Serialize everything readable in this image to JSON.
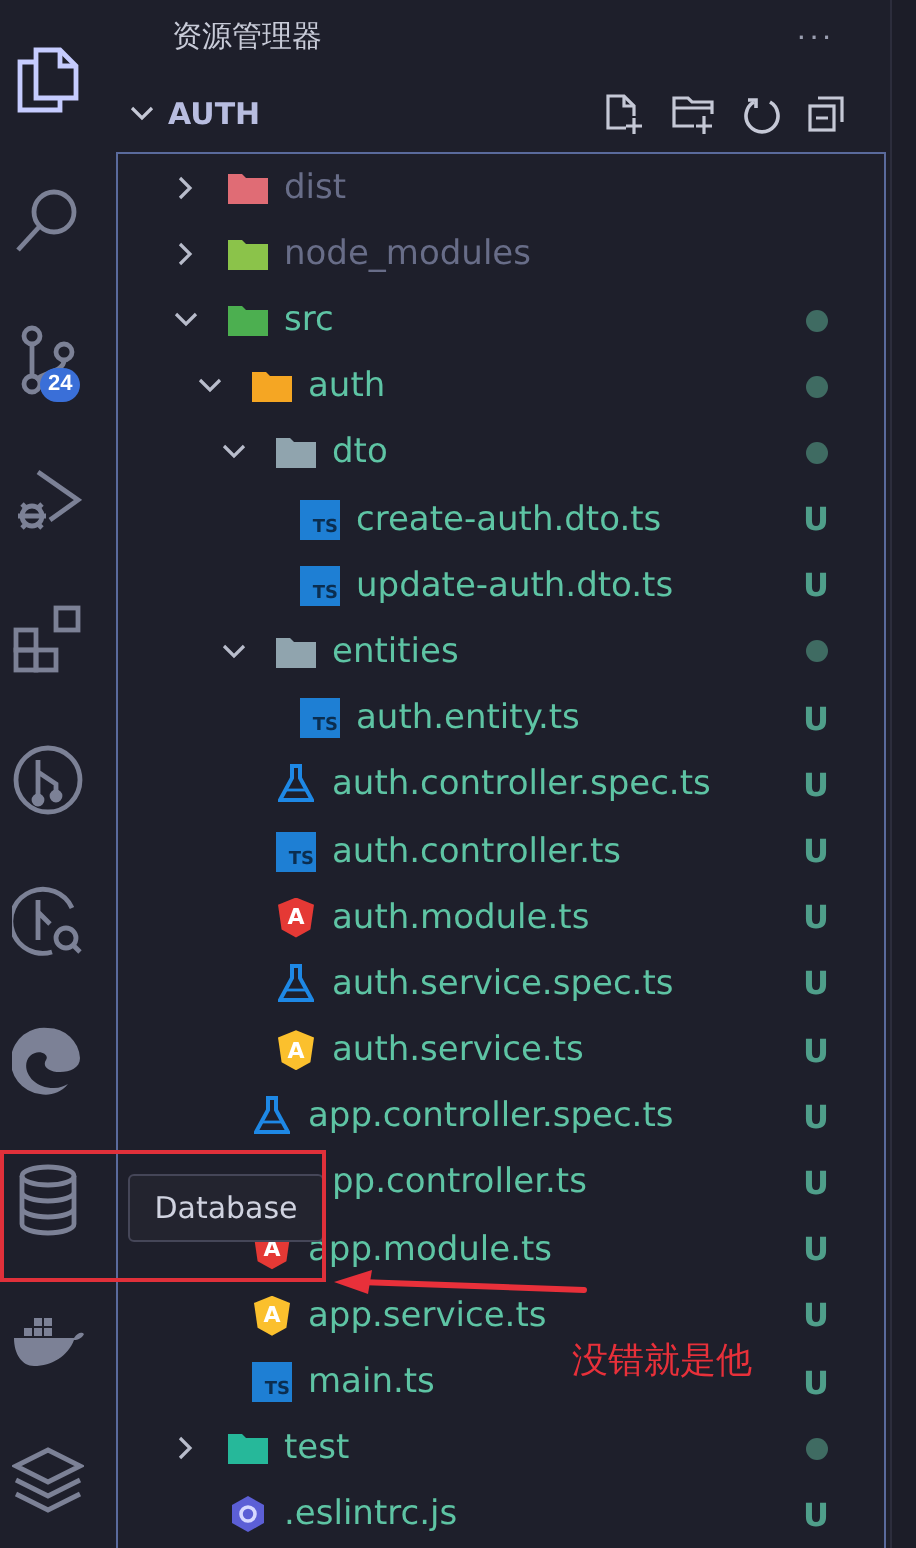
{
  "activity_bar": [
    {
      "kind": "explorer",
      "selected": true
    },
    {
      "kind": "search",
      "selected": false
    },
    {
      "kind": "source_control",
      "selected": false,
      "badge": "24"
    },
    {
      "kind": "run",
      "selected": false
    },
    {
      "kind": "extensions",
      "selected": false
    },
    {
      "kind": "git_graph",
      "selected": false
    },
    {
      "kind": "git_search",
      "selected": false
    },
    {
      "kind": "edge",
      "selected": false
    },
    {
      "kind": "database",
      "selected": false
    },
    {
      "kind": "docker",
      "selected": false
    },
    {
      "kind": "layers",
      "selected": false
    }
  ],
  "sidebar": {
    "title": "资源管理器",
    "more": "···",
    "section": {
      "title": "AUTH",
      "expanded": true
    }
  },
  "tree": [
    {
      "kind": "folder",
      "name": "dist",
      "color": "#e06c75",
      "expanded": false,
      "ignored": true
    },
    {
      "kind": "folder",
      "name": "node_modules",
      "color": "#8bc34a",
      "expanded": false,
      "ignored": true
    },
    {
      "kind": "folder",
      "name": "src",
      "color": "#4caf50",
      "expanded": true,
      "ignored": false,
      "modified": true,
      "children": [
        {
          "kind": "folder",
          "name": "auth",
          "color": "#f5a623",
          "expanded": true,
          "ignored": false,
          "modified": true,
          "children": [
            {
              "kind": "folder",
              "name": "dto",
              "color": "#90a4ae",
              "expanded": true,
              "ignored": false,
              "modified": true,
              "children": [
                {
                  "kind": "ts",
                  "name": "create-auth.dto.ts",
                  "icon_label": "TS",
                  "status": "U"
                },
                {
                  "kind": "ts",
                  "name": "update-auth.dto.ts",
                  "icon_label": "TS",
                  "status": "U"
                }
              ]
            },
            {
              "kind": "folder",
              "name": "entities",
              "color": "#90a4ae",
              "expanded": true,
              "ignored": false,
              "modified": true,
              "children": [
                {
                  "kind": "ts",
                  "name": "auth.entity.ts",
                  "icon_label": "TS",
                  "status": "U"
                }
              ]
            },
            {
              "kind": "spec",
              "name": "auth.controller.spec.ts",
              "status": "U"
            },
            {
              "kind": "ts",
              "name": "auth.controller.ts",
              "icon_label": "TS",
              "status": "U"
            },
            {
              "kind": "angular",
              "name": "auth.module.ts",
              "icon_label": "A",
              "color": "#e53935",
              "status": "U"
            },
            {
              "kind": "spec",
              "name": "auth.service.spec.ts",
              "status": "U"
            },
            {
              "kind": "angular",
              "name": "auth.service.ts",
              "icon_label": "A",
              "color": "#fbc02d",
              "status": "U"
            }
          ]
        },
        {
          "kind": "spec",
          "name": "app.controller.spec.ts",
          "status": "U"
        },
        {
          "kind": "covered",
          "name": "pp.controller.ts",
          "status": "U"
        },
        {
          "kind": "angular",
          "name": "app.module.ts",
          "icon_label": "A",
          "color": "#e53935",
          "status": "U"
        },
        {
          "kind": "angular",
          "name": "app.service.ts",
          "icon_label": "A",
          "color": "#fbc02d",
          "status": "U"
        },
        {
          "kind": "ts",
          "name": "main.ts",
          "icon_label": "TS",
          "status": "U"
        }
      ]
    },
    {
      "kind": "folder",
      "name": "test",
      "color": "#26b89a",
      "expanded": false,
      "ignored": false,
      "modified": true
    },
    {
      "kind": "eslint",
      "name": ".eslintrc.js",
      "status": "U"
    }
  ],
  "tooltip": {
    "text": "Database"
  },
  "annotation": {
    "text": "没错就是他"
  }
}
